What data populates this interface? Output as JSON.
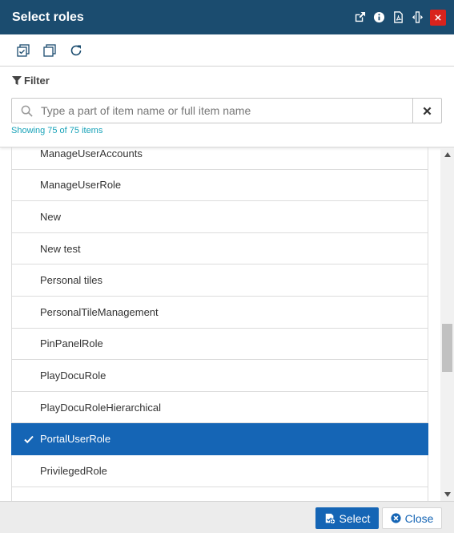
{
  "window": {
    "title": "Select roles",
    "icons": [
      "popout-icon",
      "info-icon",
      "pdf-icon",
      "resize-width-icon",
      "close-icon"
    ]
  },
  "toolbar": {
    "icons": [
      "select-all-icon",
      "deselect-all-icon",
      "refresh-icon"
    ]
  },
  "filter": {
    "label": "Filter",
    "placeholder": "Type a part of item name or full item name",
    "value": "",
    "showing": "Showing 75 of 75 items"
  },
  "list": {
    "items": [
      {
        "label": "ManageUserAccounts",
        "selected": false
      },
      {
        "label": "ManageUserRole",
        "selected": false
      },
      {
        "label": "New",
        "selected": false
      },
      {
        "label": "New test",
        "selected": false
      },
      {
        "label": "Personal tiles",
        "selected": false
      },
      {
        "label": "PersonalTileManagement",
        "selected": false
      },
      {
        "label": "PinPanelRole",
        "selected": false
      },
      {
        "label": "PlayDocuRole",
        "selected": false
      },
      {
        "label": "PlayDocuRoleHierarchical",
        "selected": false
      },
      {
        "label": "PortalUserRole",
        "selected": true
      },
      {
        "label": "PrivilegedRole",
        "selected": false
      },
      {
        "label": "",
        "selected": false
      }
    ]
  },
  "footer": {
    "select_label": "Select",
    "close_label": "Close"
  },
  "colors": {
    "titlebar": "#1b4c6f",
    "accent": "#1565b5",
    "close_red": "#d9231d",
    "info_text": "#17a2b8"
  }
}
